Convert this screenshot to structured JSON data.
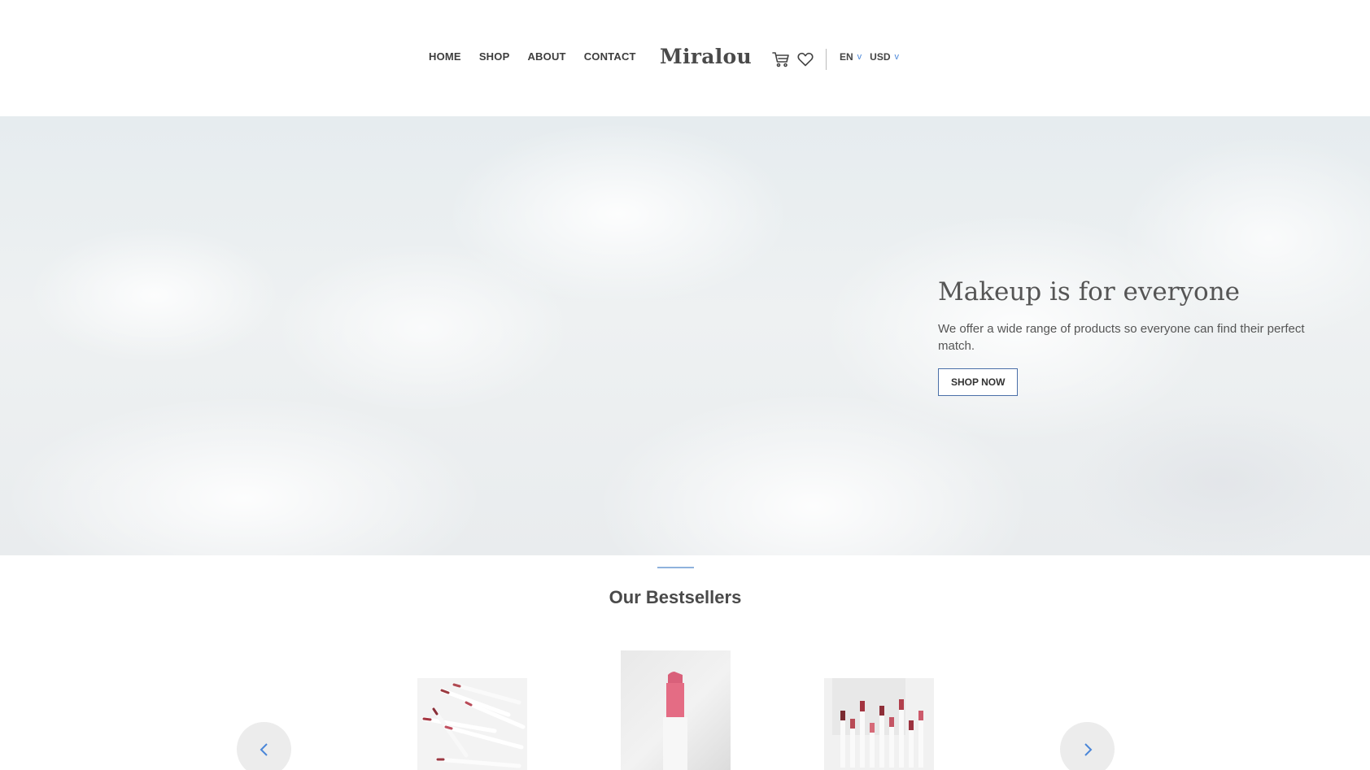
{
  "header": {
    "nav": [
      "HOME",
      "SHOP",
      "ABOUT",
      "CONTACT"
    ],
    "logo": "Miralou",
    "language": "EN",
    "currency": "USD",
    "icons": [
      "cart-icon",
      "heart-icon"
    ]
  },
  "hero": {
    "title": "Makeup is for everyone",
    "subtitle": "We offer a wide range of products so everyone can find their perfect match.",
    "cta": "SHOP NOW"
  },
  "bestsellers": {
    "title": "Our Bestsellers",
    "products": [
      "lip-liner-pencils-image",
      "pink-lipstick-image",
      "lipstick-collection-image"
    ],
    "prev_icon": "chevron-left-icon",
    "next_icon": "chevron-right-icon"
  },
  "colors": {
    "accent": "#4a86d8",
    "text": "#444444",
    "divider": "#8fb2dd",
    "lipstick": "#d9607a"
  }
}
